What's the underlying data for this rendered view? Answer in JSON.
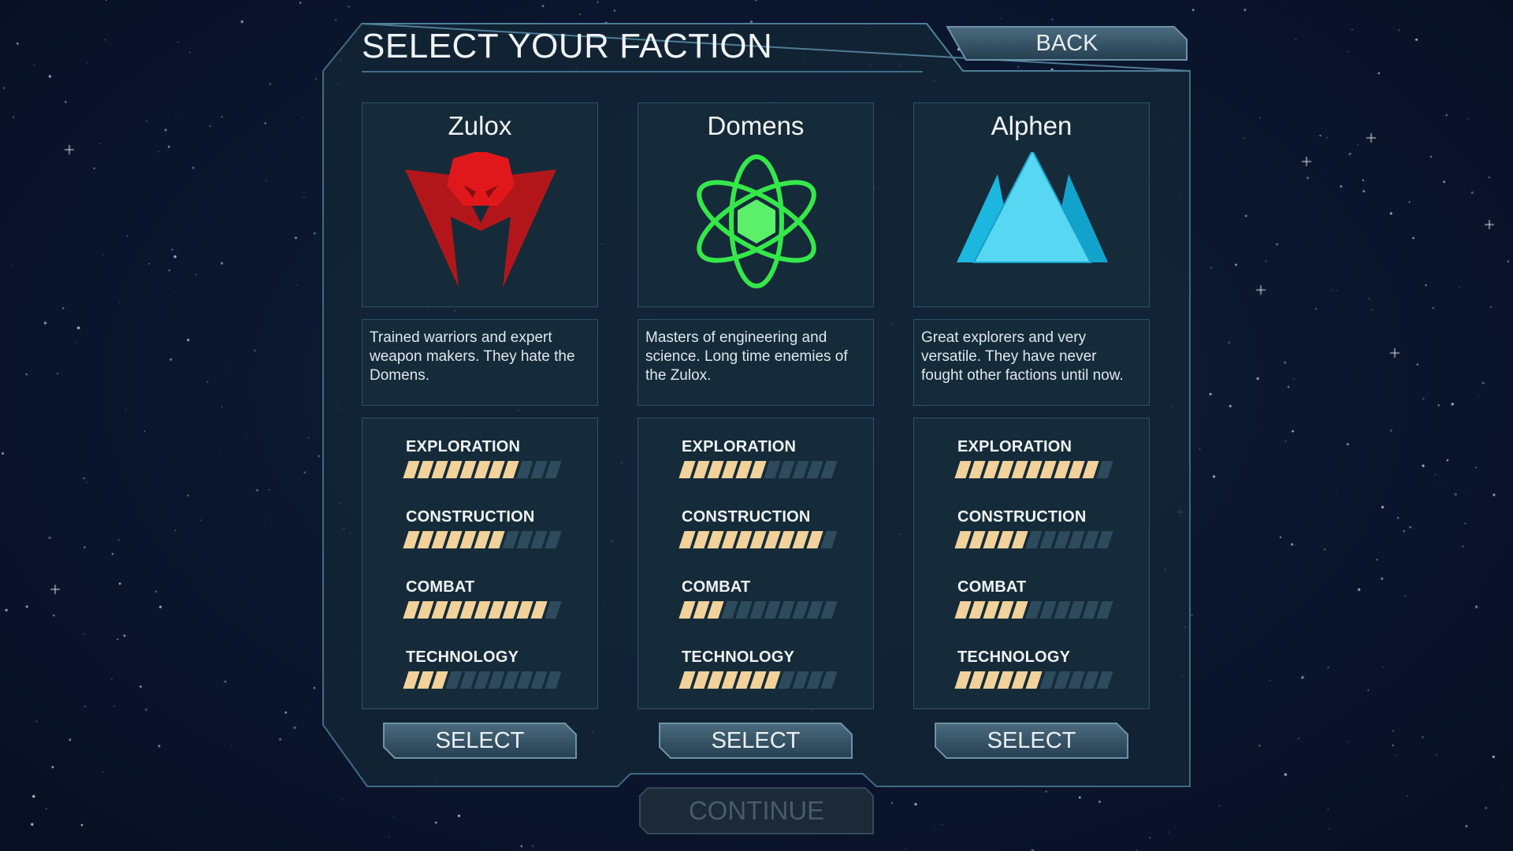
{
  "screen": {
    "title": "SELECT YOUR FACTION",
    "back_label": "BACK",
    "continue_label": "CONTINUE"
  },
  "colors": {
    "stat_on": "#f2d29a",
    "stat_off": "#2d4b5c",
    "zulox": "#d61a1a",
    "domens": "#35e84a",
    "alphen": "#45d3ef"
  },
  "factions": [
    {
      "name": "Zulox",
      "icon": "red-mask-emblem-icon",
      "description": "Trained warriors and expert weapon makers. They hate the Domens.",
      "select_label": "SELECT",
      "stats": [
        {
          "label": "EXPLORATION",
          "value": 8,
          "max": 11
        },
        {
          "label": "CONSTRUCTION",
          "value": 7,
          "max": 11
        },
        {
          "label": "COMBAT",
          "value": 10,
          "max": 11
        },
        {
          "label": "TECHNOLOGY",
          "value": 3,
          "max": 11
        }
      ]
    },
    {
      "name": "Domens",
      "icon": "green-atom-emblem-icon",
      "description": "Masters of engineering and science. Long time enemies of the Zulox.",
      "select_label": "SELECT",
      "stats": [
        {
          "label": "EXPLORATION",
          "value": 6,
          "max": 11
        },
        {
          "label": "CONSTRUCTION",
          "value": 10,
          "max": 11
        },
        {
          "label": "COMBAT",
          "value": 3,
          "max": 11
        },
        {
          "label": "TECHNOLOGY",
          "value": 7,
          "max": 11
        }
      ]
    },
    {
      "name": "Alphen",
      "icon": "blue-mountain-emblem-icon",
      "description": "Great explorers and very versatile. They have never fought other factions until now.",
      "select_label": "SELECT",
      "stats": [
        {
          "label": "EXPLORATION",
          "value": 10,
          "max": 11
        },
        {
          "label": "CONSTRUCTION",
          "value": 5,
          "max": 11
        },
        {
          "label": "COMBAT",
          "value": 5,
          "max": 11
        },
        {
          "label": "TECHNOLOGY",
          "value": 6,
          "max": 11
        }
      ]
    }
  ]
}
